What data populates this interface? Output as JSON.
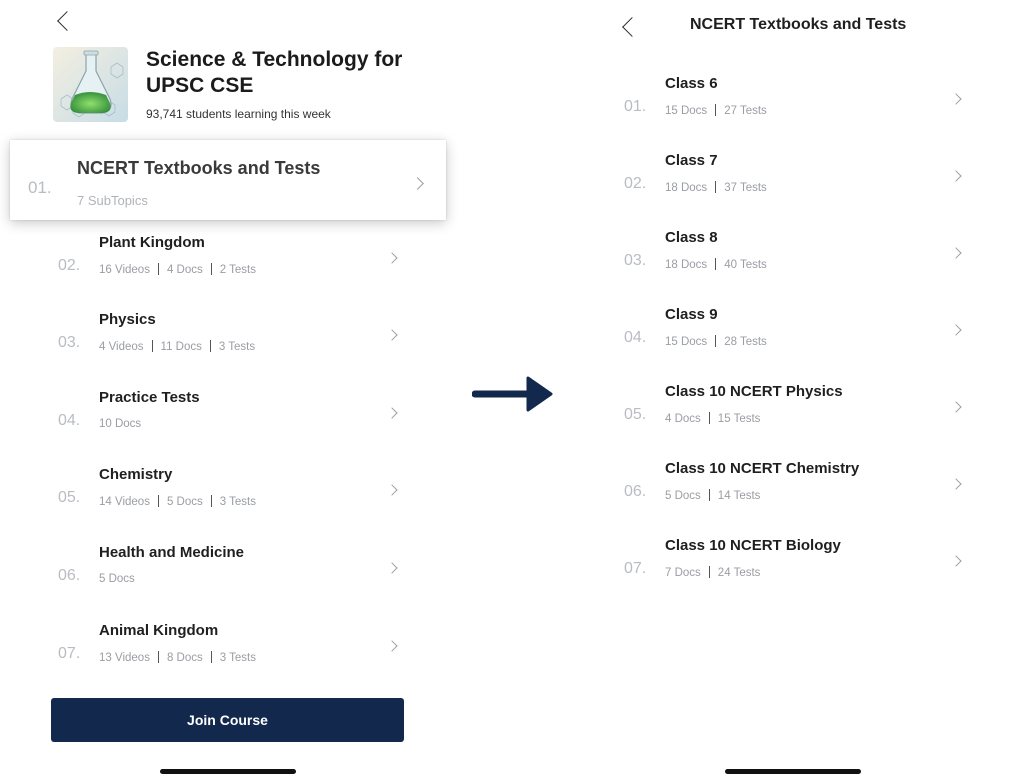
{
  "left": {
    "course": {
      "title": "Science & Technology for UPSC CSE",
      "students": "93,741 students learning this week"
    },
    "highlighted": {
      "number": "01.",
      "title": "NCERT Textbooks and Tests",
      "meta": "7 SubTopics"
    },
    "rows": [
      {
        "number": "02.",
        "title": "Plant Kingdom",
        "meta": [
          "16 Videos",
          "4 Docs",
          "2 Tests"
        ]
      },
      {
        "number": "03.",
        "title": "Physics",
        "meta": [
          "4 Videos",
          "11 Docs",
          "3 Tests"
        ]
      },
      {
        "number": "04.",
        "title": "Practice Tests",
        "meta": [
          "10 Docs"
        ]
      },
      {
        "number": "05.",
        "title": "Chemistry",
        "meta": [
          "14 Videos",
          "5 Docs",
          "3 Tests"
        ]
      },
      {
        "number": "06.",
        "title": "Health and Medicine",
        "meta": [
          "5 Docs"
        ]
      },
      {
        "number": "07.",
        "title": "Animal Kingdom",
        "meta": [
          "13 Videos",
          "8 Docs",
          "3 Tests"
        ]
      }
    ],
    "join_label": "Join Course"
  },
  "right": {
    "title": "NCERT Textbooks and Tests",
    "rows": [
      {
        "number": "01.",
        "title": "Class 6",
        "meta": [
          "15 Docs",
          "27 Tests"
        ]
      },
      {
        "number": "02.",
        "title": "Class 7",
        "meta": [
          "18 Docs",
          "37 Tests"
        ]
      },
      {
        "number": "03.",
        "title": "Class 8",
        "meta": [
          "18 Docs",
          "40 Tests"
        ]
      },
      {
        "number": "04.",
        "title": "Class 9",
        "meta": [
          "15 Docs",
          "28 Tests"
        ]
      },
      {
        "number": "05.",
        "title": "Class 10 NCERT Physics",
        "meta": [
          "4 Docs",
          "15 Tests"
        ]
      },
      {
        "number": "06.",
        "title": "Class 10 NCERT Chemistry",
        "meta": [
          "5 Docs",
          "14 Tests"
        ]
      },
      {
        "number": "07.",
        "title": "Class 10 NCERT Biology",
        "meta": [
          "7 Docs",
          "24 Tests"
        ]
      }
    ]
  },
  "icons": {
    "back": "chevron-left-icon",
    "row": "chevron-right-icon",
    "transition": "arrow-right-icon",
    "course_thumbnail": "flask-image"
  },
  "colors": {
    "button": "#12284c",
    "arrow": "#12284c",
    "muted_text": "#9a9da3"
  }
}
